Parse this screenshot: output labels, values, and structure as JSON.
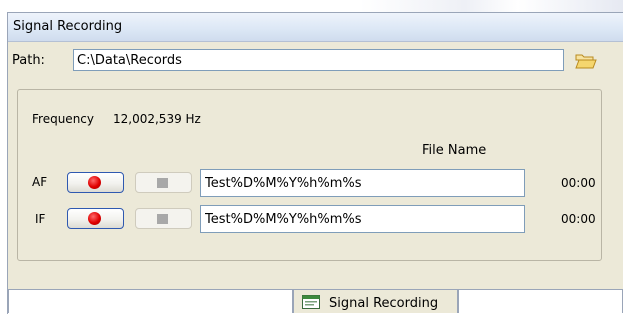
{
  "window": {
    "title": "Signal Recording"
  },
  "path": {
    "label": "Path:",
    "value": "C:\\Data\\Records",
    "browse_icon": "folder-open-icon"
  },
  "frequency": {
    "label": "Frequency",
    "value": "12,002,539 Hz"
  },
  "table": {
    "column_header": "File Name"
  },
  "channels": [
    {
      "label": "AF",
      "filename": "Test%D%M%Y%h%m%s",
      "time": "00:00"
    },
    {
      "label": "IF",
      "filename": "Test%D%M%Y%h%m%s",
      "time": "00:00"
    }
  ],
  "tab": {
    "label": "Signal Recording",
    "icon": "window-icon"
  },
  "colors": {
    "record": "#e00000",
    "accent_border": "#2f59b0",
    "panel": "#ece9d8"
  }
}
